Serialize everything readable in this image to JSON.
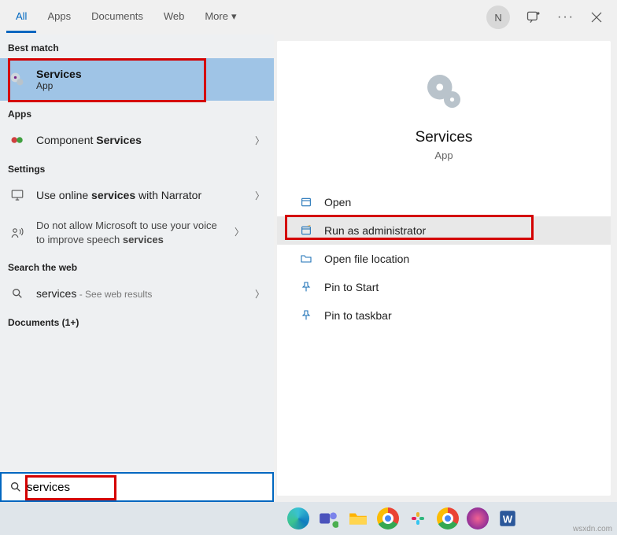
{
  "tabs": {
    "all": "All",
    "apps": "Apps",
    "documents": "Documents",
    "web": "Web",
    "more": "More"
  },
  "avatar": "N",
  "sections": {
    "best_match": "Best match",
    "apps": "Apps",
    "settings": "Settings",
    "search_web": "Search the web",
    "documents": "Documents (1+)"
  },
  "best": {
    "title": "Services",
    "sub": "App"
  },
  "app_item": {
    "prefix": "Component ",
    "bold": "Services"
  },
  "setting1": {
    "t1": "Use online ",
    "t2": "services",
    "t3": " with Narrator"
  },
  "setting2": {
    "t1": "Do not allow Microsoft to use your voice to improve speech ",
    "t2": "services"
  },
  "web_item": {
    "term": "services",
    "suffix": " - See web results"
  },
  "detail": {
    "title": "Services",
    "sub": "App"
  },
  "actions": {
    "open": "Open",
    "run_admin": "Run as administrator",
    "open_loc": "Open file location",
    "pin_start": "Pin to Start",
    "pin_taskbar": "Pin to taskbar"
  },
  "search": {
    "value": "services"
  },
  "watermark": "wsxdn.com"
}
